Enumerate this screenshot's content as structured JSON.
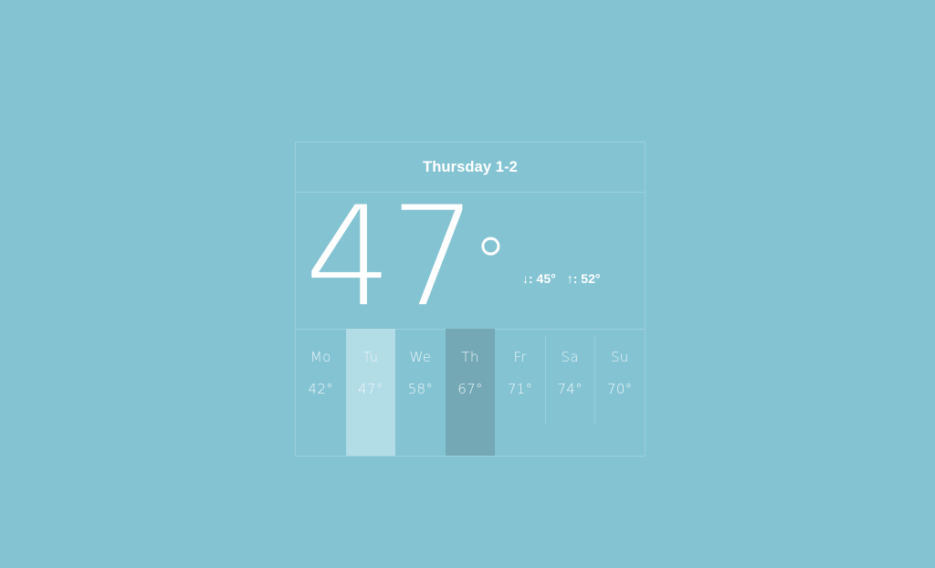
{
  "background_color": "#84c3d2",
  "border_color": "#9ccfdb",
  "text_color": "#ffffff",
  "widget": {
    "header": {
      "title": "Thursday 1-2"
    },
    "current": {
      "temperature": "47",
      "degree_symbol": "°",
      "low": {
        "icon": "↓",
        "label": ": 45°"
      },
      "high": {
        "icon": "↑",
        "label": ": 52°"
      }
    },
    "forecast": {
      "days": [
        {
          "name": "Mo",
          "temp": "42°",
          "state": "normal"
        },
        {
          "name": "Tu",
          "temp": "47°",
          "state": "hovered"
        },
        {
          "name": "We",
          "temp": "58°",
          "state": "normal"
        },
        {
          "name": "Th",
          "temp": "67°",
          "state": "selected"
        },
        {
          "name": "Fr",
          "temp": "71°",
          "state": "normal"
        },
        {
          "name": "Sa",
          "temp": "74°",
          "state": "normal"
        },
        {
          "name": "Su",
          "temp": "70°",
          "state": "normal"
        }
      ],
      "selected_color": "#74a8b5",
      "hovered_color": "#b2dce6"
    }
  }
}
